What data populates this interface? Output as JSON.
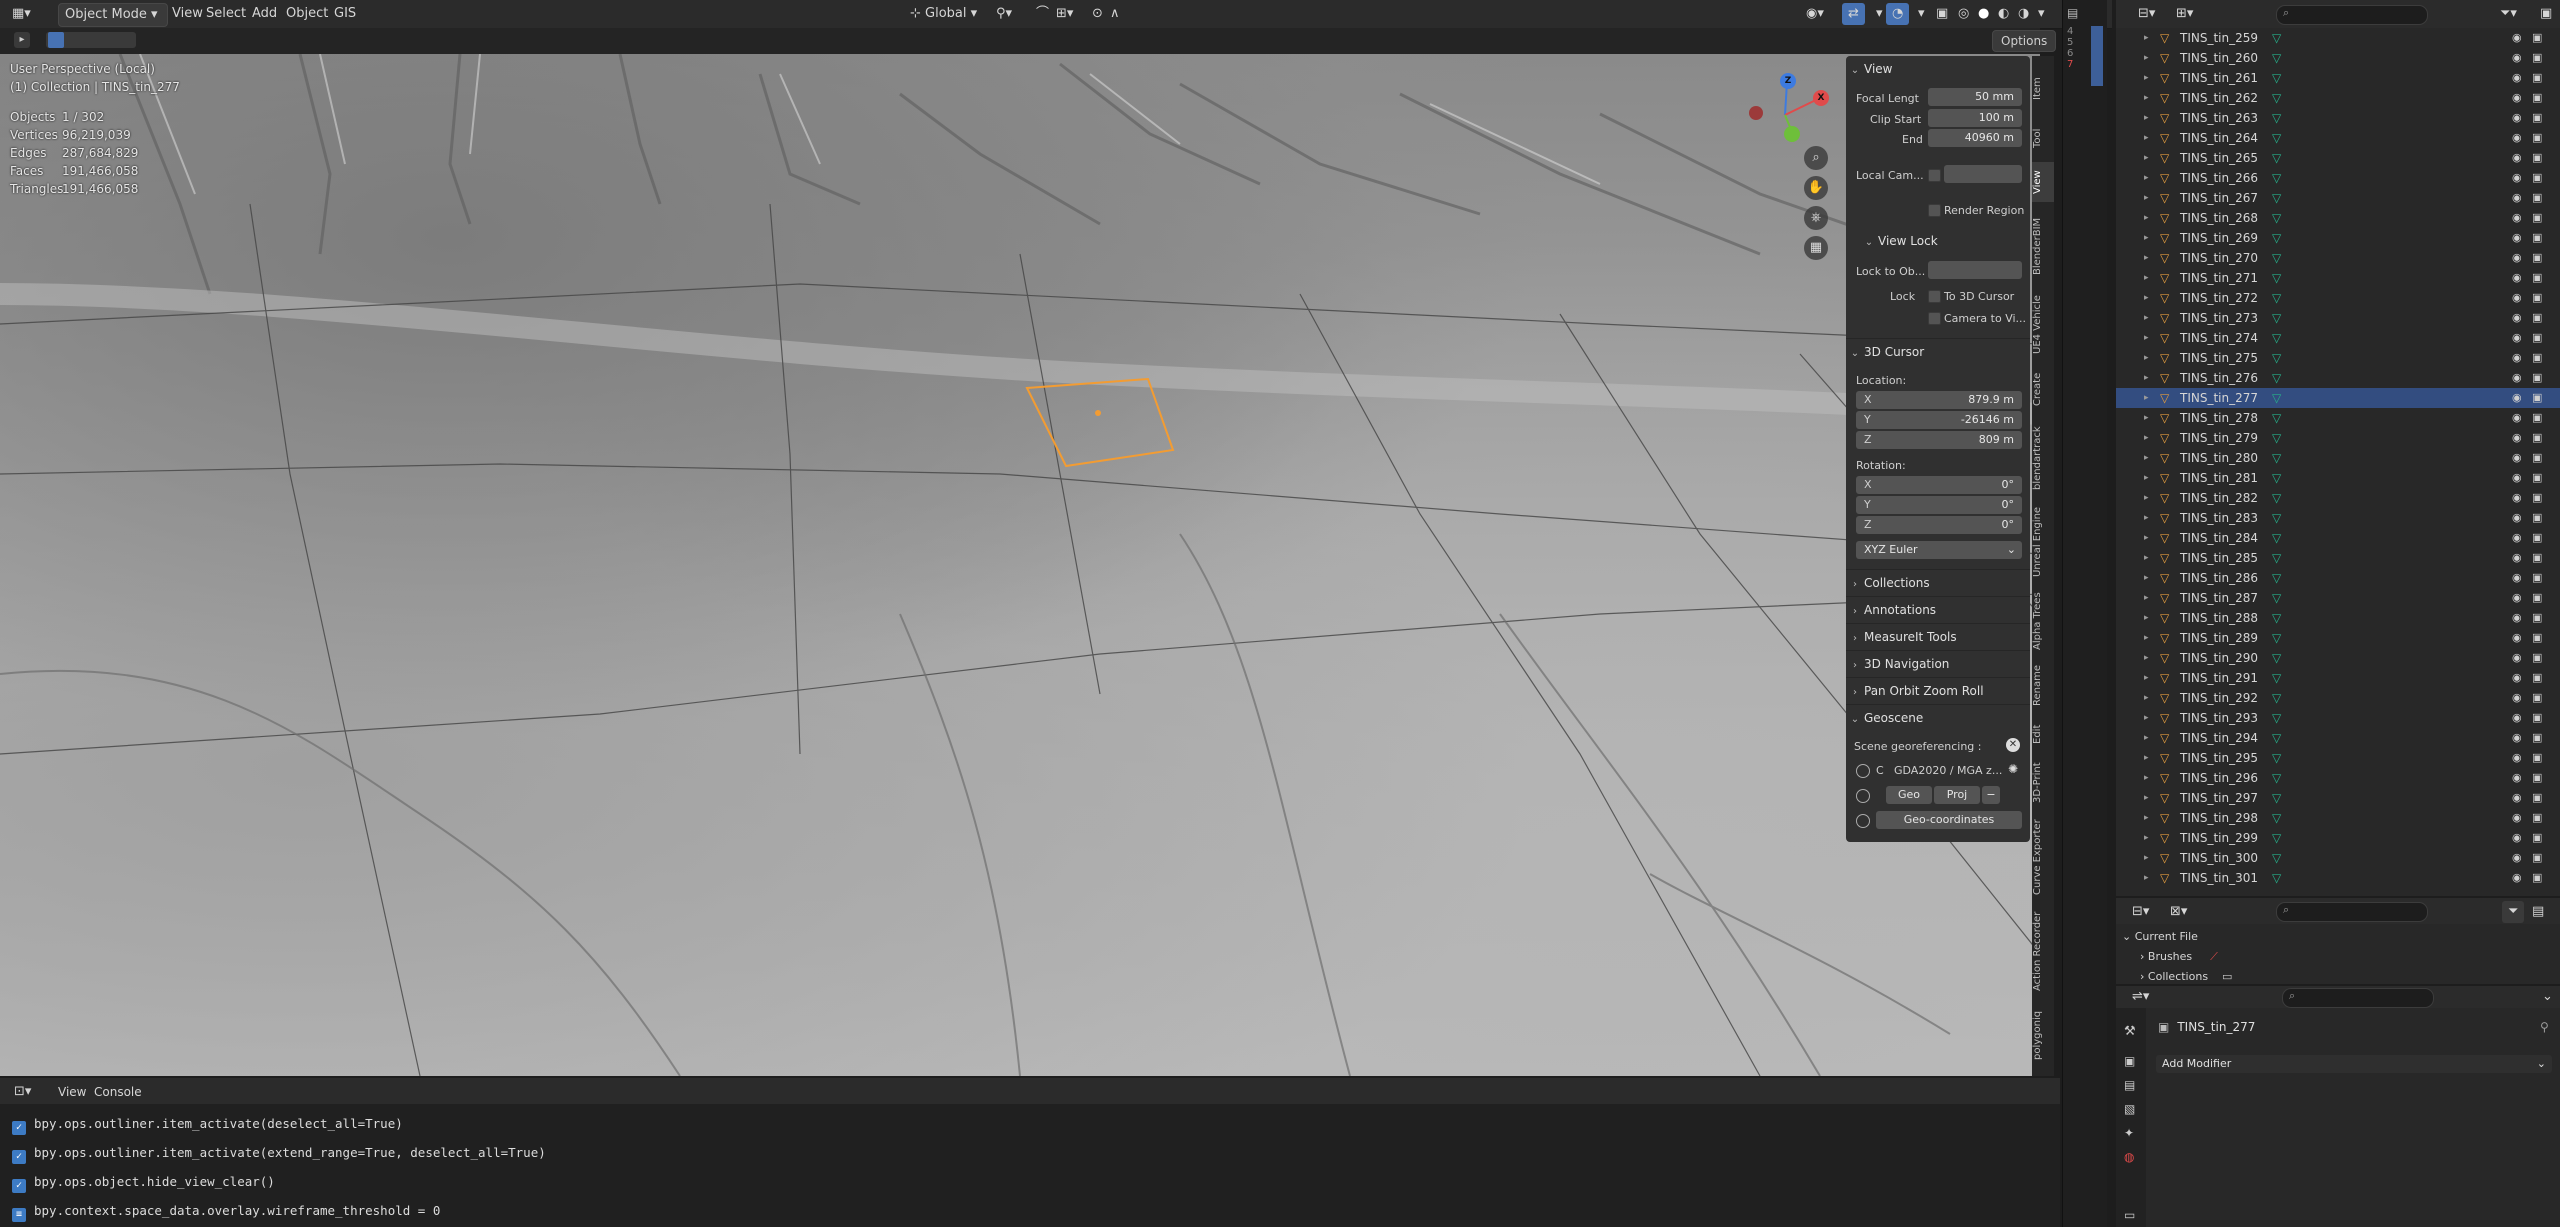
{
  "header": {
    "mode": "Object Mode",
    "menus": [
      "View",
      "Select",
      "Add",
      "Object",
      "GIS"
    ],
    "orientation": "Global",
    "options_label": "Options"
  },
  "viewport": {
    "perspective": "User Perspective (Local)",
    "collection_info": "(1) Collection | TINS_tin_277",
    "stats": [
      {
        "label": "Objects",
        "value": "1 / 302"
      },
      {
        "label": "Vertices",
        "value": "96,219,039"
      },
      {
        "label": "Edges",
        "value": "287,684,829"
      },
      {
        "label": "Faces",
        "value": "191,466,058"
      },
      {
        "label": "Triangles",
        "value": "191,466,058"
      }
    ],
    "gizmo": {
      "x": "X",
      "y": "Y",
      "z": "Z"
    }
  },
  "npanel": {
    "view_header": "View",
    "focal_label": "Focal Lengt",
    "focal_value": "50 mm",
    "clip_start_label": "Clip Start",
    "clip_start_value": "100 m",
    "clip_end_label": "End",
    "clip_end_value": "40960 m",
    "local_cam_label": "Local Cam...",
    "render_region_label": "Render Region",
    "view_lock_header": "View Lock",
    "lock_to_obj_label": "Lock to Ob...",
    "lock_label": "Lock",
    "to_3d_cursor_label": "To 3D Cursor",
    "camera_to_view_label": "Camera to Vi...",
    "cursor_header": "3D Cursor",
    "location_label": "Location:",
    "loc": [
      {
        "k": "X",
        "v": "879.9 m"
      },
      {
        "k": "Y",
        "v": "-26146 m"
      },
      {
        "k": "Z",
        "v": "809 m"
      }
    ],
    "rotation_label": "Rotation:",
    "rot": [
      {
        "k": "X",
        "v": "0°"
      },
      {
        "k": "Y",
        "v": "0°"
      },
      {
        "k": "Z",
        "v": "0°"
      }
    ],
    "euler": "XYZ Euler",
    "collapsed": [
      "Collections",
      "Annotations",
      "MeasureIt Tools",
      "3D Navigation",
      "Pan Orbit Zoom Roll"
    ],
    "geoscene_header": "Geoscene",
    "scene_geo_label": "Scene georeferencing :",
    "crs_prefix": "C",
    "crs_value": "GDA2020 / MGA z...",
    "geo_btn": "Geo",
    "proj_btn": "Proj",
    "geo_coords_btn": "Geo-coordinates"
  },
  "side_tabs": [
    "Item",
    "Tool",
    "View",
    "BlenderBIM",
    "UE4 Vehicle",
    "Create",
    "blendartrack",
    "Unreal Engine",
    "Alpha Trees",
    "Rename",
    "Edit",
    "3D-Print",
    "Curve Exporter",
    "Action Recorder",
    "polygoniq"
  ],
  "console": {
    "menus": [
      "View",
      "Console"
    ],
    "lines": [
      "bpy.ops.outliner.item_activate(deselect_all=True)",
      "bpy.ops.outliner.item_activate(extend_range=True, deselect_all=True)",
      "bpy.ops.object.hide_view_clear()",
      "bpy.context.space_data.overlay.wireframe_threshold = 0"
    ]
  },
  "line_numbers": [
    "4",
    "5",
    "6",
    "7"
  ],
  "outliner": {
    "items": [
      "TINS_tin_259",
      "TINS_tin_260",
      "TINS_tin_261",
      "TINS_tin_262",
      "TINS_tin_263",
      "TINS_tin_264",
      "TINS_tin_265",
      "TINS_tin_266",
      "TINS_tin_267",
      "TINS_tin_268",
      "TINS_tin_269",
      "TINS_tin_270",
      "TINS_tin_271",
      "TINS_tin_272",
      "TINS_tin_273",
      "TINS_tin_274",
      "TINS_tin_275",
      "TINS_tin_276",
      "TINS_tin_277",
      "TINS_tin_278",
      "TINS_tin_279",
      "TINS_tin_280",
      "TINS_tin_281",
      "TINS_tin_282",
      "TINS_tin_283",
      "TINS_tin_284",
      "TINS_tin_285",
      "TINS_tin_286",
      "TINS_tin_287",
      "TINS_tin_288",
      "TINS_tin_289",
      "TINS_tin_290",
      "TINS_tin_291",
      "TINS_tin_292",
      "TINS_tin_293",
      "TINS_tin_294",
      "TINS_tin_295",
      "TINS_tin_296",
      "TINS_tin_297",
      "TINS_tin_298",
      "TINS_tin_299",
      "TINS_tin_300",
      "TINS_tin_301"
    ],
    "selected": "TINS_tin_277"
  },
  "blend_file": {
    "root": "Current File",
    "items": [
      "Brushes",
      "Collections"
    ]
  },
  "properties": {
    "object_name": "TINS_tin_277",
    "add_modifier": "Add Modifier"
  },
  "colors": {
    "accent": "#4772b3",
    "selection_outline": "#f39c32",
    "mesh_icon": "#e09a3e",
    "data_icon": "#26b08a"
  }
}
